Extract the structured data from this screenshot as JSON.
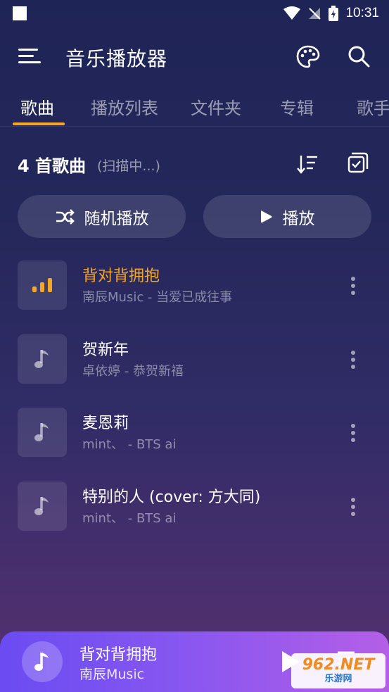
{
  "status_bar": {
    "time": "10:31"
  },
  "app_bar": {
    "title": "音乐播放器"
  },
  "tabs": [
    {
      "label": "歌曲",
      "active": true
    },
    {
      "label": "播放列表",
      "active": false
    },
    {
      "label": "文件夹",
      "active": false
    },
    {
      "label": "专辑",
      "active": false
    },
    {
      "label": "歌手",
      "active": false
    }
  ],
  "list_header": {
    "count_label": "4 首歌曲",
    "scan_status": "(扫描中...)"
  },
  "actions": {
    "shuffle_label": "随机播放",
    "play_label": "播放"
  },
  "songs": [
    {
      "title": "背对背拥抱",
      "subtitle": "南辰Music - 当爱已成往事",
      "playing": true
    },
    {
      "title": "贺新年",
      "subtitle": "卓依婷 - 恭贺新禧",
      "playing": false
    },
    {
      "title": "麦恩莉",
      "subtitle": "mint、 - BTS ai",
      "playing": false
    },
    {
      "title": "特别的人 (cover: 方大同)",
      "subtitle": "mint、 - BTS ai",
      "playing": false
    }
  ],
  "mini_player": {
    "title": "背对背拥抱",
    "artist": "南辰Music"
  },
  "watermark": {
    "top": "962.NET",
    "bottom": "乐游网"
  },
  "colors": {
    "accent": "#f5a623",
    "background_top": "#1f2456",
    "background_bottom": "#563070",
    "mini_player_start": "#6a4cf2",
    "mini_player_end": "#b45fe6"
  }
}
